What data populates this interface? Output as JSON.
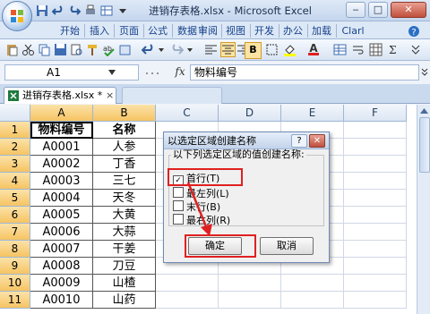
{
  "window": {
    "title": "进销存表格.xlsx - Microsoft Excel",
    "minimize": "‒",
    "restore": "□",
    "close": "✕"
  },
  "ribbon_tabs": [
    "开始",
    "插入",
    "页面",
    "公式",
    "数据",
    "审阅",
    "视图",
    "开发",
    "办公",
    "加载",
    "Clarl"
  ],
  "toolbar": {
    "bold": "B",
    "font_color": "A"
  },
  "formula_bar": {
    "name_box": "A1",
    "fx": "fx",
    "content": "物料编号"
  },
  "workbook_tab": {
    "label": "进销存表格.xlsx *",
    "close": "×"
  },
  "grid": {
    "columns": [
      "A",
      "B",
      "C",
      "D",
      "E",
      "F"
    ],
    "rows": [
      "1",
      "2",
      "3",
      "4",
      "5",
      "6",
      "7",
      "8",
      "9",
      "10",
      "11"
    ],
    "headers": [
      "物料编号",
      "名称"
    ],
    "data": [
      [
        "A0001",
        "人参"
      ],
      [
        "A0002",
        "丁香"
      ],
      [
        "A0003",
        "三七"
      ],
      [
        "A0004",
        "天冬"
      ],
      [
        "A0005",
        "大黄"
      ],
      [
        "A0006",
        "大蒜"
      ],
      [
        "A0007",
        "干姜"
      ],
      [
        "A0008",
        "刀豆"
      ],
      [
        "A0009",
        "山楂"
      ],
      [
        "A0010",
        "山药"
      ]
    ]
  },
  "dialog": {
    "title": "以选定区域创建名称",
    "help": "?",
    "close": "✕",
    "group_label": "以下列选定区域的值创建名称:",
    "options": [
      {
        "label": "首行(T)",
        "checked": true
      },
      {
        "label": "最左列(L)",
        "checked": false
      },
      {
        "label": "末行(B)",
        "checked": false
      },
      {
        "label": "最右列(R)",
        "checked": false
      }
    ],
    "ok": "确定",
    "cancel": "取消"
  },
  "colors": {
    "highlight": "#e02020",
    "selected_header": "#f6c463"
  }
}
